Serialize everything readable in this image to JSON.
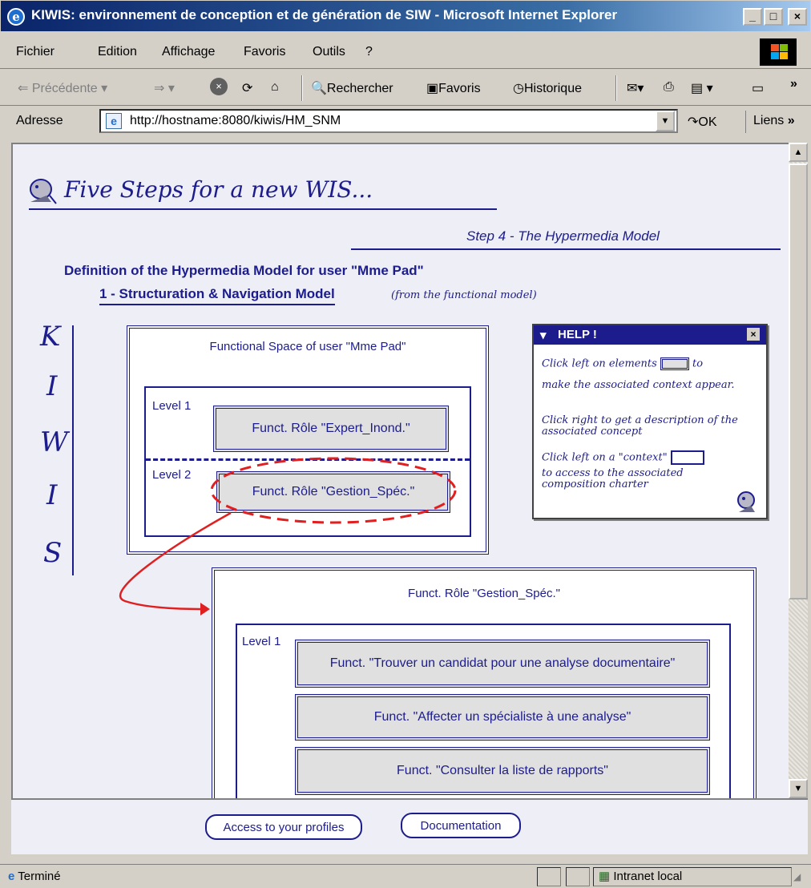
{
  "window": {
    "title": "KIWIS: environnement de conception et de génération de SIW - Microsoft Internet Explorer",
    "minimize": "_",
    "maximize": "□",
    "close": "×"
  },
  "menu": [
    "Fichier",
    "Edition",
    "Affichage",
    "Favoris",
    "Outils",
    "?"
  ],
  "toolbar": {
    "back": "Précédente",
    "search": "Rechercher",
    "favorites": "Favoris",
    "history": "Historique"
  },
  "address": {
    "label": "Adresse",
    "url": "http://hostname:8080/kiwis/HM_SNM",
    "go": "OK",
    "links": "Liens"
  },
  "page": {
    "heading": "Five Steps for a new WIS...",
    "step": "Step 4 - The Hypermedia Model",
    "definition": "Definition of the Hypermedia Model for user \"Mme Pad\"",
    "model_title": "1 - Structuration & Navigation Model",
    "model_note": "(from the functional model)",
    "side_letters": [
      "K",
      "I",
      "W",
      "I",
      "S"
    ]
  },
  "functional_space": {
    "title": "Functional Space of user \"Mme Pad\"",
    "level1_label": "Level 1",
    "level1_role": "Funct. Rôle \"Expert_Inond.\"",
    "level2_label": "Level 2",
    "level2_role": "Funct. Rôle \"Gestion_Spéc.\""
  },
  "role_panel": {
    "title": "Funct. Rôle \"Gestion_Spéc.\"",
    "level_label": "Level 1",
    "functions": [
      "Funct. \"Trouver un candidat pour une analyse documentaire\"",
      "Funct. \"Affecter un spécialiste à une analyse\"",
      "Funct. \"Consulter la liste de rapports\""
    ]
  },
  "help": {
    "title": "HELP !",
    "line1a": "Click left on elements",
    "line1b": "to",
    "line1c": "make the associated context appear.",
    "line2": "Click right to get a description of the associated concept",
    "line3a": "Click left on a \"context\"",
    "line3b": "to access to the associated composition charter"
  },
  "bottom": {
    "profiles": "Access to your profiles",
    "documentation": "Documentation"
  },
  "status": {
    "text": "Terminé",
    "zone": "Intranet local"
  },
  "colors": {
    "navy": "#1c1c8c",
    "title_bar": "#0a246a",
    "highlight": "#e02020"
  }
}
